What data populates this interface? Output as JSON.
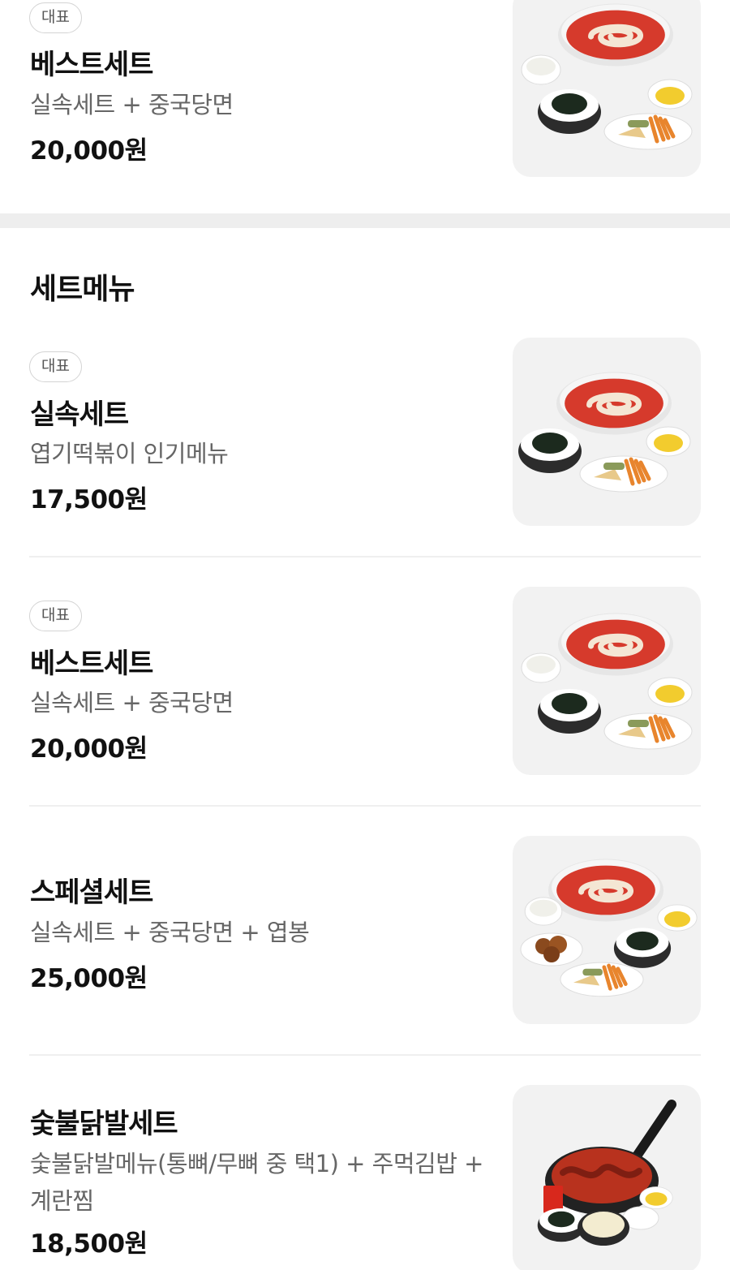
{
  "top_item": {
    "badge": "대표",
    "name": "베스트세트",
    "description": "실속세트 + 중국당면",
    "price": "20,000원",
    "image": "best-set-photo"
  },
  "section": {
    "title": "세트메뉴",
    "items": [
      {
        "badge": "대표",
        "name": "실속세트",
        "description": "엽기떡볶이 인기메뉴",
        "price": "17,500원",
        "image": "value-set-photo"
      },
      {
        "badge": "대표",
        "name": "베스트세트",
        "description": "실속세트 + 중국당면",
        "price": "20,000원",
        "image": "best-set-photo"
      },
      {
        "badge": "",
        "name": "스페셜세트",
        "description": "실속세트 + 중국당면 + 엽봉",
        "price": "25,000원",
        "image": "special-set-photo"
      },
      {
        "badge": "",
        "name": "숯불닭발세트",
        "description": "숯불닭발메뉴(통뼈/무뼈 중 택1) + 주먹김밥 + 계란찜",
        "price": "18,500원",
        "image": "chicken-feet-set-photo"
      }
    ]
  },
  "colors": {
    "badge_border": "#d4d4d4",
    "description": "#666666",
    "section_gap": "#eeeeee",
    "thumb_bg": "#f2f2f2",
    "sauce": "#d9342b"
  }
}
